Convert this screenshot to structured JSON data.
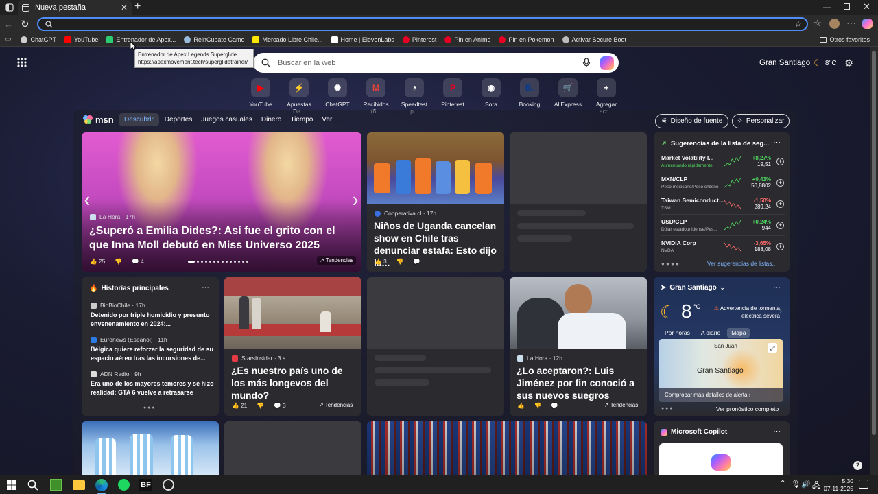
{
  "browser": {
    "tab_title": "Nueva pestaña",
    "favorites": [
      {
        "label": "ChatGPT",
        "icon": "chatgpt-icon",
        "color": "#cfcfcf"
      },
      {
        "label": "YouTube",
        "icon": "youtube-icon",
        "color": "#ff0000"
      },
      {
        "label": "Entrenador de Apex...",
        "icon": "apex-icon",
        "color": "#2ecc71"
      },
      {
        "label": "ReinCubate Camo",
        "icon": "camo-icon",
        "color": "#9bd"
      },
      {
        "label": "Mercado Libre Chile...",
        "icon": "mercadolibre-icon",
        "color": "#ffe600"
      },
      {
        "label": "Home | ElevenLabs",
        "icon": "elevenlabs-icon",
        "color": "#ffffff"
      },
      {
        "label": "Pinterest",
        "icon": "pinterest-icon",
        "color": "#e60023"
      },
      {
        "label": "Pin en Anime",
        "icon": "pinterest-icon",
        "color": "#e60023"
      },
      {
        "label": "Pin en Pokemon",
        "icon": "pinterest-icon",
        "color": "#e60023"
      },
      {
        "label": "Activar Secure Boot",
        "icon": "globe-icon",
        "color": "#bbbbbb"
      }
    ],
    "other_favorites": "Otros favoritos",
    "tooltip": {
      "title": "Entrenador de Apex Legends Superglide",
      "url": "https://apexmovement.tech/superglidetrainer/"
    }
  },
  "newtab": {
    "location": "Gran Santiago",
    "temp": "8°C",
    "search_placeholder": "Buscar en la web",
    "quicklinks": [
      {
        "label": "YouTube",
        "color": "#ff0000",
        "glyph": "▶"
      },
      {
        "label": "Apuestas De...",
        "color": "#b6ff00",
        "glyph": "⚡"
      },
      {
        "label": "ChatGPT",
        "color": "#ffffff",
        "glyph": "✺"
      },
      {
        "label": "Recibidos (6...",
        "color": "#ea4335",
        "glyph": "M"
      },
      {
        "label": "Speedtest p...",
        "color": "#ffffff",
        "glyph": "◔"
      },
      {
        "label": "Pinterest",
        "color": "#e60023",
        "glyph": "P"
      },
      {
        "label": "Sora",
        "color": "#ffffff",
        "glyph": "◉"
      },
      {
        "label": "Booking",
        "color": "#003b95",
        "glyph": "B."
      },
      {
        "label": "AliExpress",
        "color": "#e62e04",
        "glyph": "🛒"
      },
      {
        "label": "Agregar acc...",
        "color": "#ffffff",
        "glyph": "+"
      }
    ]
  },
  "msn": {
    "logo": "msn",
    "nav": [
      "Descubrir",
      "Deportes",
      "Juegos casuales",
      "Dinero",
      "Tiempo",
      "Ver"
    ],
    "design_btn": "Diseño de fuente",
    "personalize_btn": "Personalizar",
    "hero": {
      "source": "La Hora · 17h",
      "title": "¿Superó a Emilia Dides?: Así fue el grito con el que Inna Moll debutó en Miss Universo 2025",
      "likes": "25",
      "comments": "4",
      "trending": "Tendencias"
    },
    "uganda": {
      "source": "Cooperativa.cl · 17h",
      "title": "Niños de Uganda cancelan show en Chile tras denunciar estafa: Esto dijo la...",
      "likes": "3"
    },
    "stocks": {
      "title": "Sugerencias de la lista de seg...",
      "items": [
        {
          "name": "Market Volatility I...",
          "sub": "Aumentando rápidamente",
          "change": "+8,27%",
          "value": "19,51",
          "up": true
        },
        {
          "name": "MXN/CLP",
          "sub": "Peso mexicano/Peso chileno",
          "change": "+0,43%",
          "value": "50,8802",
          "up": true
        },
        {
          "name": "Taiwan Semiconduct...",
          "sub": "TSM",
          "change": "-1,50%",
          "value": "289,24",
          "up": false
        },
        {
          "name": "USD/CLP",
          "sub": "Dólar estadounidense/Pes...",
          "change": "+0,24%",
          "value": "944",
          "up": true
        },
        {
          "name": "NVIDIA Corp",
          "sub": "NVDA",
          "change": "-3,65%",
          "value": "188,08",
          "up": false
        }
      ],
      "more": "Ver sugerencias de listas..."
    },
    "top_stories": {
      "title": "Historias principales",
      "items": [
        {
          "source": "BioBioChile · 17h",
          "title": "Detenido por triple homicidio y presunto envenenamiento en 2024:...",
          "color": "#cccccc"
        },
        {
          "source": "Euronews (Español) · 11h",
          "title": "Bélgica quiere reforzar la seguridad de su espacio aéreo tras las incursiones de...",
          "color": "#2d7be5"
        },
        {
          "source": "ADN Radio · 9h",
          "title": "Era uno de los mayores temores y se hizo realidad: GTA 6 vuelve a retrasarse",
          "color": "#dddddd"
        }
      ]
    },
    "longevos": {
      "source": "StarsInsider · 3 s",
      "title": "¿Es nuestro país uno de los más longevos del mundo?",
      "likes": "21",
      "comments": "3",
      "trending": "Tendencias"
    },
    "jimenez": {
      "source": "La Hora · 12h",
      "title": "¿Lo aceptaron?: Luis Jiménez por fin conoció a sus nuevos suegros",
      "trending": "Tendencias"
    },
    "weather": {
      "location": "Gran Santiago",
      "temp": "8",
      "unit": "°C",
      "alert": "Advertencia de tormenta eléctrica severa",
      "tabs": [
        "Por horas",
        "A diario",
        "Mapa"
      ],
      "map_label_top": "San Juan",
      "map_label": "Gran Santiago",
      "alert_link": "Comprobar más detalles de alerta",
      "forecast_link": "Ver pronóstico completo"
    },
    "copilot": {
      "title": "Microsoft Copilot"
    }
  },
  "taskbar": {
    "time": "5:30",
    "date": "07-11-2025",
    "apps": [
      "start-icon",
      "search-icon",
      "minecraft-icon",
      "file-explorer-icon",
      "edge-icon",
      "spotify-icon",
      "bf-icon",
      "steam-icon"
    ],
    "bf_label": "BF"
  }
}
